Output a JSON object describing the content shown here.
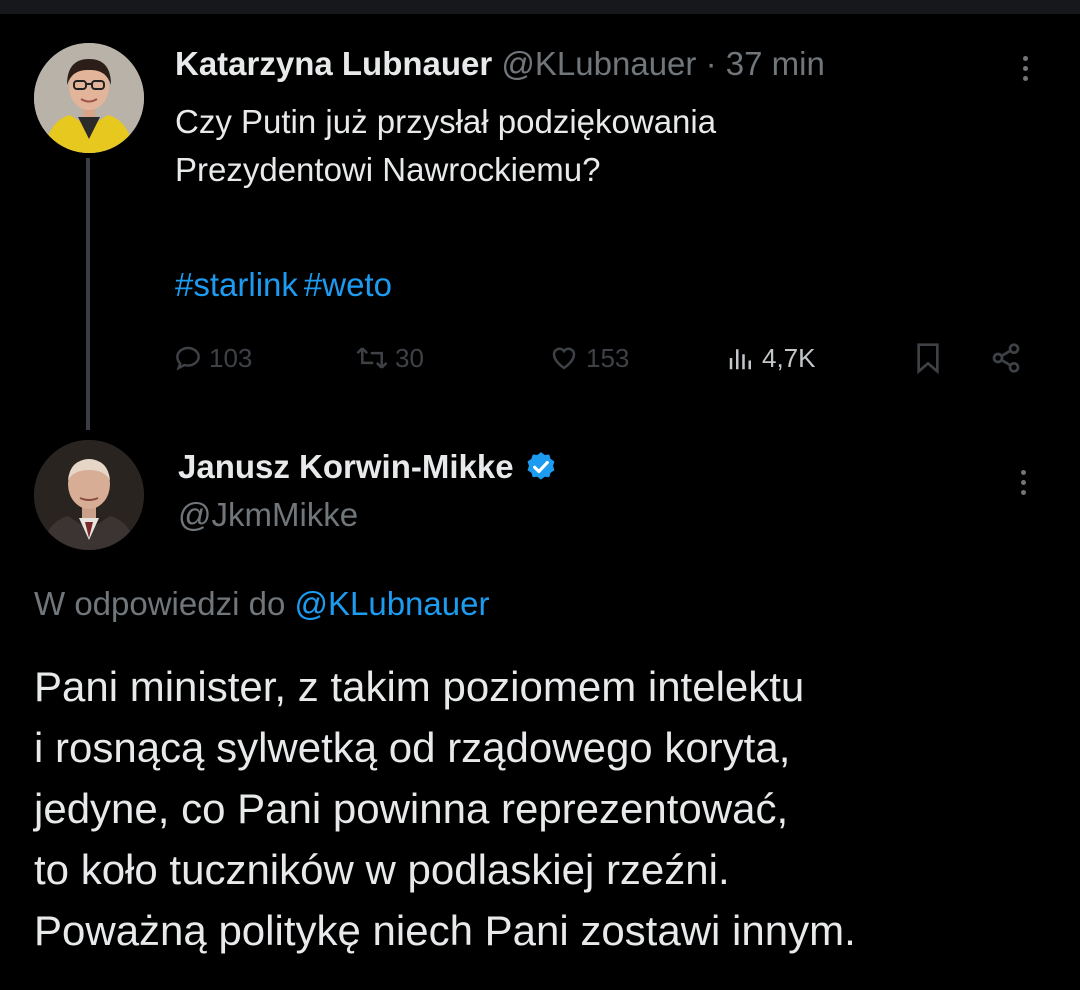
{
  "tweet1": {
    "author_name": "Katarzyna Lubnauer",
    "author_handle": "@KLubnauer",
    "time": "37 min",
    "separator": "·",
    "text_lines": [
      "Czy Putin już przysłał podziękowania",
      "Prezydentowi Nawrockiemu?"
    ],
    "hashtags": [
      "#starlink",
      "#weto"
    ],
    "actions": {
      "reply_count": "103",
      "retweet_count": "30",
      "like_count": "153",
      "views_count": "4,7K"
    },
    "icons": [
      "reply-icon",
      "retweet-icon",
      "like-icon",
      "views-icon",
      "bookmark-icon",
      "share-icon",
      "more-icon"
    ]
  },
  "tweet2": {
    "author_name": "Janusz Korwin-Mikke",
    "author_handle": "@JkmMikke",
    "verified": true,
    "reply_to_prefix": "W odpowiedzi do",
    "reply_to_handle": "@KLubnauer",
    "text_lines": [
      "Pani minister, z takim poziomem intelektu",
      "i rosnącą sylwetką od rządowego koryta,",
      "jedyne, co Pani powinna reprezentować,",
      "to koło tuczników w podlaskiej rzeźni.",
      "Poważną politykę niech Pani zostawi innym."
    ]
  },
  "colors": {
    "background": "#000000",
    "text": "#e7e9ea",
    "secondary": "#71767b",
    "accent": "#1d9bf0",
    "verified": "#1d9bf0"
  }
}
